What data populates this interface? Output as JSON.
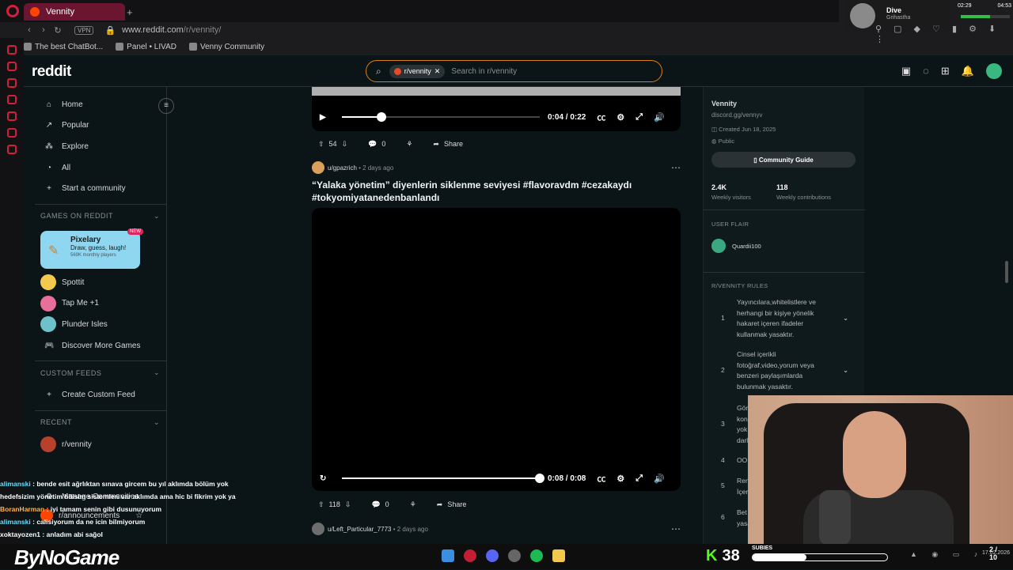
{
  "browser": {
    "tab_title": "Vennity",
    "url_host": "www.reddit.com",
    "url_path": "/r/vennity/",
    "vpn_label": "VPN",
    "bookmarks": [
      "The best ChatBot...",
      "Panel • LIVAD",
      "Venny Community"
    ]
  },
  "stream_top": {
    "name": "Dive",
    "sub": "Grihastha",
    "time1": "02:29",
    "time2": "04:53"
  },
  "header": {
    "logo": "reddit",
    "search_chip": "r/vennity",
    "search_placeholder": "Search in r/vennity"
  },
  "leftnav": {
    "items": [
      "Home",
      "Popular",
      "Explore",
      "All",
      "Start a community"
    ],
    "games_title": "GAMES ON REDDIT",
    "pixelary": {
      "name": "Pixelary",
      "desc": "Draw, guess, laugh!",
      "players": "569K monthly players",
      "badge": "NEW"
    },
    "games": [
      "Spottit",
      "Tap Me +1",
      "Plunder Isles"
    ],
    "discover": "Discover More Games",
    "custom_title": "CUSTOM FEEDS",
    "create_feed": "Create Custom Feed",
    "recent_title": "RECENT",
    "recent": [
      "r/vennity"
    ],
    "manage": "Manage Communities",
    "announcements": "r/announcements"
  },
  "feed": {
    "video1": {
      "time": "0:04 / 0:22",
      "progress": 0.2
    },
    "post1_actions": {
      "votes": "54",
      "comments": "0",
      "share": "Share"
    },
    "post2": {
      "user": "u/gpazrich",
      "age": "2 days ago",
      "title": "“Yalaka yönetim” diyenlerin siklenme seviyesi #flavoravdm #cezakaydı #tokyomiyatanedenbanlandı",
      "time": "0:08 / 0:08",
      "progress": 1.0,
      "votes": "118",
      "comments": "0",
      "share": "Share"
    },
    "post3": {
      "user": "u/Left_Particular_7773",
      "age": "2 days ago"
    }
  },
  "sidebar": {
    "name": "Vennity",
    "link": "discord.gg/vennyv",
    "created": "Created Jun 18, 2025",
    "visibility": "Public",
    "guide": "Community Guide",
    "visitors": "2.4K",
    "visitors_label": "Weekly visitors",
    "contribs": "118",
    "contribs_label": "Weekly contributions",
    "flair_title": "USER FLAIR",
    "flair_user": "Quardii100",
    "rules_title": "R/VENNITY RULES",
    "rules": [
      {
        "n": "1",
        "text": "Yayıncılara,whitelistlere ve herhangi bir kişiye yönelik hakaret içeren ifadeler kullanmak yasaktır."
      },
      {
        "n": "2",
        "text": "Cinsel içerikli fotoğraf,video,yorum veya benzeri paylaşımlarda bulunmak yasaktır."
      },
      {
        "n": "3",
        "text": "Gön kon yok darl"
      },
      {
        "n": "4",
        "text": "OO"
      },
      {
        "n": "5",
        "text": "Ren İçer"
      },
      {
        "n": "6",
        "text": "Bet yasa"
      }
    ]
  },
  "chat": [
    {
      "user": "alimanski",
      "msg": "bende esit ağrlıktan sınava gircem bu yıl aklımda bölüm yok hedefsizim yönetim bilisim sistemleri var aklımda ama hic bi fikrim yok ya"
    },
    {
      "user": "BoranHarman",
      "msg": "iyi tamam senin gibi dusunuyorum"
    },
    {
      "user": "alimanski",
      "msg": "calisiyorum da ne icin bilmiyorum"
    },
    {
      "user": "xoktayozen1",
      "msg": "anladım abi sağol"
    }
  ],
  "taskbar": {
    "brand": "ByNoGame",
    "kick_count": "38",
    "subies_label": "SUBIES",
    "subies_count": "2 / 10",
    "date": "17.02.2026"
  }
}
